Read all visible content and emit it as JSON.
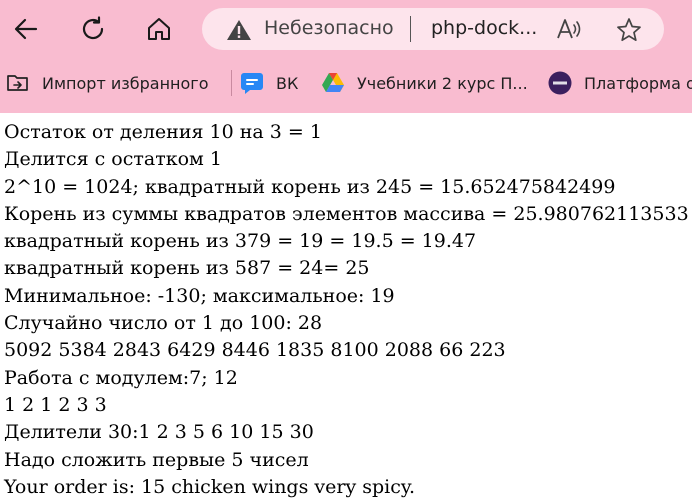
{
  "browser": {
    "security_label": "Небезопасно",
    "url": "php-dock...",
    "chrome_color": "#f9bcd0"
  },
  "bookmarks": [
    {
      "label": "Импорт избранного",
      "icon": "import-folder-icon"
    },
    {
      "label": "ВК",
      "icon": "vk-chat-icon"
    },
    {
      "label": "Учебники 2 курс П...",
      "icon": "google-drive-icon"
    },
    {
      "label": "Платформа о",
      "icon": "bfu-logo-icon"
    }
  ],
  "output": {
    "lines": [
      "Остаток от деления 10 на 3 = 1",
      "Делится с остатком 1",
      "2^10 = 1024; квадратный корень из 245 = 15.652475842499",
      "Корень из суммы квадратов элементов массива = 25.980762113533",
      "квадратный корень из 379 = 19 = 19.5 = 19.47",
      "квадратный корень из 587 = 24= 25",
      "Минимальное: -130; максимальное: 19",
      "Случайно число от 1 до 100: 28",
      "5092 5384 2843 6429 8446 1835 8100 2088 66 223",
      "Работа с модулем:7; 12",
      "1 2 1 2 3 3",
      "Делители 30:1 2 3 5 6 10 15 30",
      "Надо сложить первые 5 чисел",
      "Your order is: 15 chicken wings very spicy."
    ]
  }
}
